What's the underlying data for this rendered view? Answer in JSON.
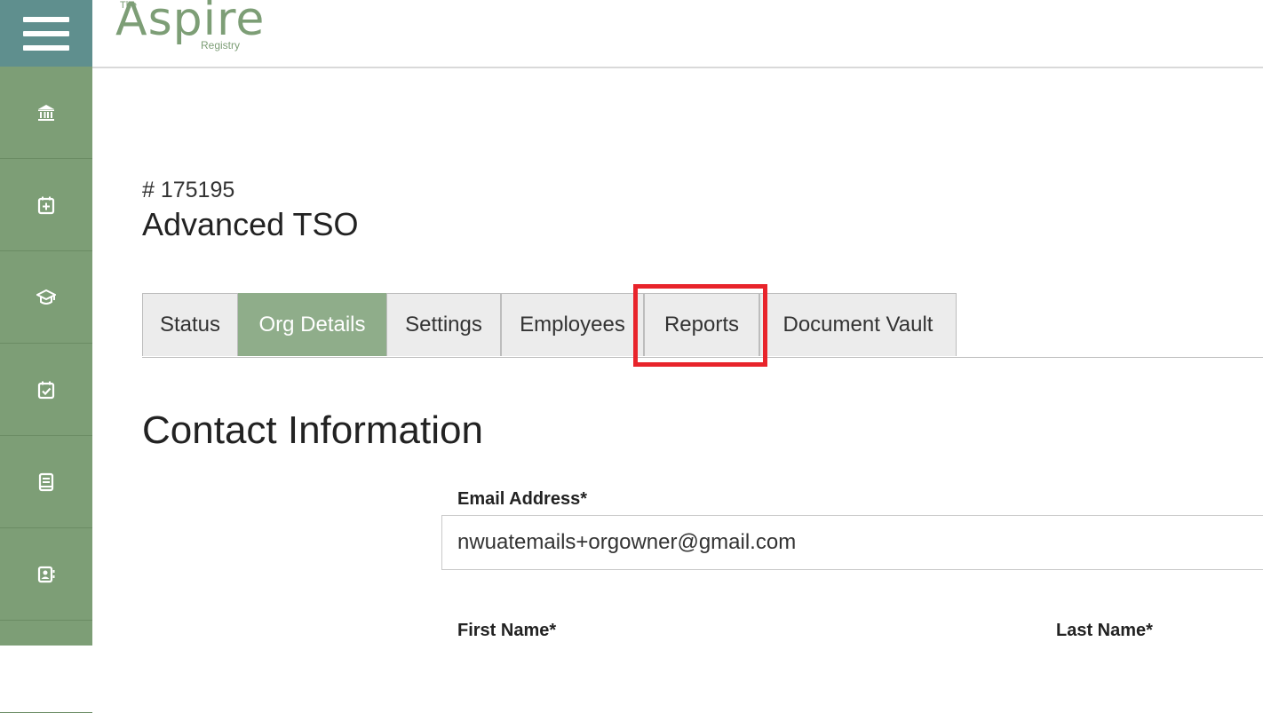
{
  "header": {
    "logo": {
      "the": "The",
      "word": "Aspire",
      "registry": "Registry"
    }
  },
  "sidebar": {
    "items": [
      {
        "icon": "bank-icon"
      },
      {
        "icon": "calendar-plus-icon"
      },
      {
        "icon": "graduation-cap-icon"
      },
      {
        "icon": "calendar-check-icon"
      },
      {
        "icon": "book-icon"
      },
      {
        "icon": "contact-book-icon"
      }
    ]
  },
  "org": {
    "number": "# 175195",
    "name": "Advanced TSO"
  },
  "tabs": [
    {
      "label": "Status"
    },
    {
      "label": "Org Details",
      "active": true
    },
    {
      "label": "Settings"
    },
    {
      "label": "Employees"
    },
    {
      "label": "Reports",
      "highlighted": true
    },
    {
      "label": "Document Vault"
    }
  ],
  "contact": {
    "title": "Contact Information",
    "email_label": "Email Address*",
    "email_value": "nwuatemails+orgowner@gmail.com",
    "first_name_label": "First Name*",
    "last_name_label": "Last Name*"
  },
  "colors": {
    "sidebar": "#7d9e76",
    "menu_button": "#5f8f8e",
    "active_tab": "#8fad8a",
    "highlight": "#e8242b"
  }
}
